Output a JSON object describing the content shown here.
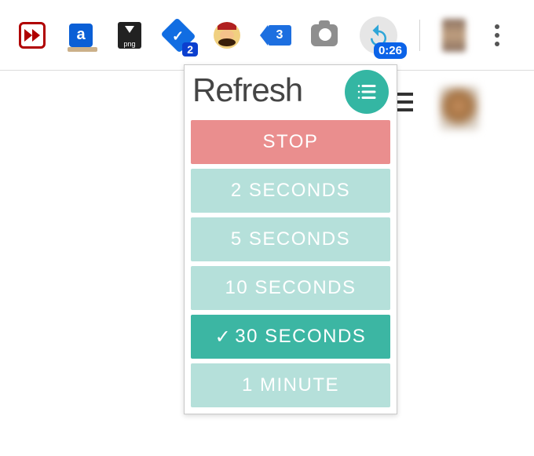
{
  "toolbar": {
    "inbox_badge": "2",
    "refresh_badge": "0:26"
  },
  "popup": {
    "title": "Refresh",
    "stop_label": "STOP",
    "options": [
      {
        "label": "2 SECONDS",
        "selected": false
      },
      {
        "label": "5 SECONDS",
        "selected": false
      },
      {
        "label": "10 SECONDS",
        "selected": false
      },
      {
        "label": "30 SECONDS",
        "selected": true
      },
      {
        "label": "1 MINUTE",
        "selected": false
      }
    ]
  }
}
